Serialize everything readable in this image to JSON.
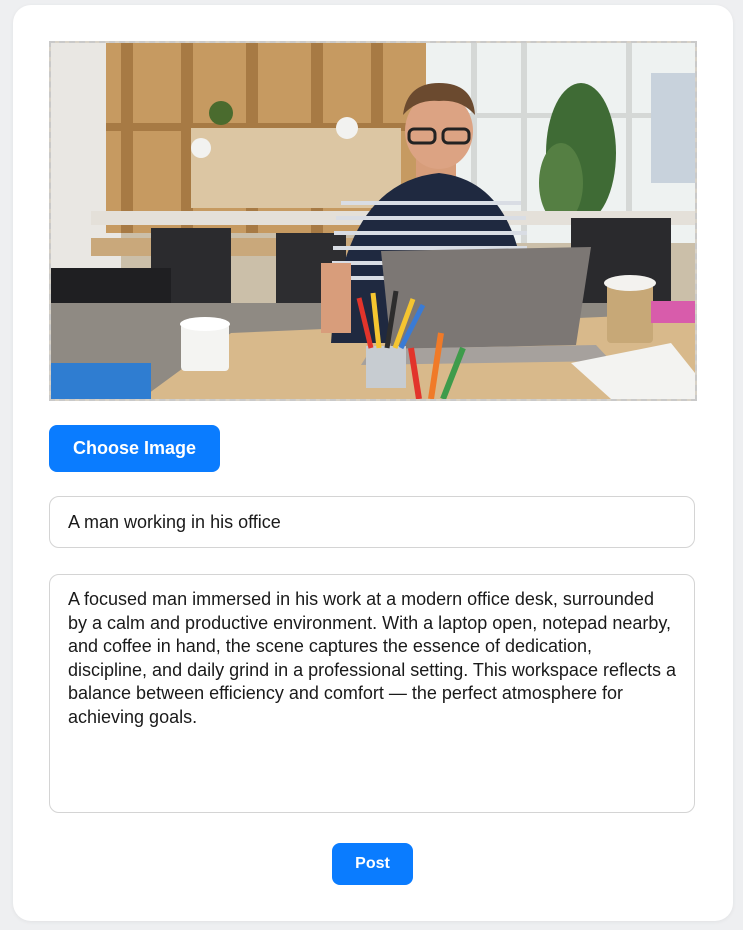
{
  "theme": {
    "accent": "#0a7cff",
    "page_background": "#eeeff1",
    "card_background": "#ffffff"
  },
  "image_preview": {
    "alt": "A man working in his office"
  },
  "choose_image_label": "Choose Image",
  "title_field": {
    "value": "A man working in his office"
  },
  "description_field": {
    "value": "A focused man immersed in his work at a modern office desk, surrounded by a calm and productive environment. With a laptop open, notepad nearby, and coffee in hand, the scene captures the essence of dedication, discipline, and daily grind in a professional setting. This workspace reflects a balance between efficiency and comfort — the perfect atmosphere for achieving goals."
  },
  "post_label": "Post"
}
